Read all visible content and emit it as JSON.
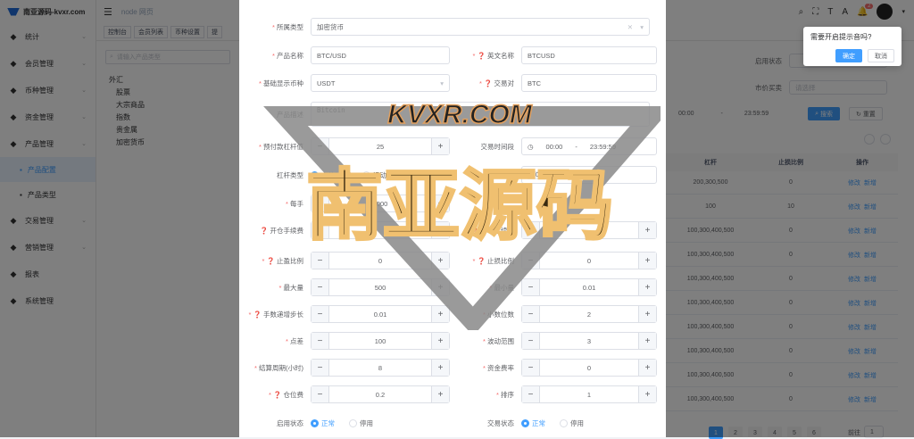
{
  "app": {
    "logo_text": "南亚源码-kvxr.com",
    "breadcrumb": "node 网页"
  },
  "sidebar": {
    "items": [
      {
        "label": "统计",
        "icon": "chart-icon"
      },
      {
        "label": "会员管理",
        "icon": "users-icon"
      },
      {
        "label": "币种管理",
        "icon": "coin-icon"
      },
      {
        "label": "资金管理",
        "icon": "wallet-icon"
      },
      {
        "label": "产品管理",
        "icon": "product-icon"
      },
      {
        "label": "产品配置",
        "icon": "config-icon",
        "sub": true,
        "active": true
      },
      {
        "label": "产品类型",
        "icon": "list-icon",
        "sub": true
      },
      {
        "label": "交易管理",
        "icon": "trade-icon"
      },
      {
        "label": "营销管理",
        "icon": "marketing-icon"
      },
      {
        "label": "报表",
        "icon": "report-icon"
      },
      {
        "label": "系统管理",
        "icon": "gear-icon"
      }
    ]
  },
  "tabs": [
    "控制台",
    "会员列表",
    "币种设置",
    "提"
  ],
  "tree": {
    "search_placeholder": "请输入产品类型",
    "nodes": [
      "外汇",
      "股票",
      "大宗商品",
      "指数",
      "贵金属",
      "加密货币"
    ]
  },
  "form": {
    "category_label": "所属类型",
    "category_value": "加密货币",
    "product_name_label": "产品名称",
    "product_name_value": "BTC/USD",
    "english_name_label": "英文名称",
    "english_name_value": "BTCUSD",
    "base_currency_label": "基础显示币种",
    "base_currency_value": "USDT",
    "trade_pair_label": "交易对",
    "trade_pair_value": "BTC",
    "desc_label": "产品描述",
    "desc_value": "Bitcoin",
    "preset_label": "预付款杠杆值",
    "preset_value": "25",
    "trade_time_label": "交易时间段",
    "time_start": "00:00",
    "time_sep": "-",
    "time_end": "23:59:59",
    "leverage_type_label": "杠杆类型",
    "leverage_opt1": "高倍杠杆",
    "leverage_opt2": "滑动倍数",
    "leverage_num_label": "杠杆倍数",
    "leverage_tags": [
      "100",
      "200",
      "500"
    ],
    "lot_label": "每手",
    "lot_value": "1000",
    "open_fee_label": "开仓手续费",
    "close_fee_label": "平仓手续费",
    "sl_label": "止盈比例",
    "sl_value": "0",
    "tp_label": "止损比例",
    "tp_value": "0",
    "max_label": "最大量",
    "max_value": "500",
    "min_label": "最小量",
    "min_value": "0.01",
    "step_label": "手数递增步长",
    "step_value": "0.01",
    "decimal_label": "小数位数",
    "decimal_value": "2",
    "spread_label": "点差",
    "spread_value": "100",
    "range_label": "波动范围",
    "range_value": "3",
    "period_label": "结算周期(小时)",
    "period_value": "8",
    "rate_label": "资金费率",
    "rate_value": "0",
    "margin_label": "仓位费",
    "margin_value": "0.2",
    "sort_label": "排序",
    "sort_value": "1",
    "enable_label": "启用状态",
    "enable_on": "正常",
    "enable_off": "停用",
    "trade_status_label": "交易状态",
    "trade_on": "正常",
    "trade_off": "停用"
  },
  "filter": {
    "enable_label": "启用状态",
    "market_label": "市价买卖",
    "market_placeholder": "请选择",
    "time_start": "00:00",
    "time_sep": "-",
    "time_end": "23:59:59",
    "search_btn": "搜索",
    "reset_btn": "重置"
  },
  "table": {
    "col_leverage": "杠杆",
    "col_stop": "止损比例",
    "col_action": "操作",
    "edit": "修改",
    "add": "新增",
    "rows": [
      [
        "200,300,500",
        "0"
      ],
      [
        "100",
        "10"
      ],
      [
        "100,300,400,500",
        "0"
      ],
      [
        "100,300,400,500",
        "0"
      ],
      [
        "100,300,400,500",
        "0"
      ],
      [
        "100,300,400,500",
        "0"
      ],
      [
        "100,300,400,500",
        "0"
      ],
      [
        "100,300,400,500",
        "0"
      ],
      [
        "100,300,400,500",
        "0"
      ],
      [
        "100,300,400,500",
        "0"
      ]
    ]
  },
  "popconfirm": {
    "text": "需要开启提示音吗?",
    "ok": "确定",
    "cancel": "取消"
  },
  "pager": {
    "pages": [
      "1",
      "2",
      "3",
      "4",
      "5",
      "6"
    ],
    "goto": "前往",
    "current": "1"
  },
  "watermark": {
    "top_text": "KVXR.COM",
    "main_text": "南亚源码"
  },
  "badge": "2"
}
